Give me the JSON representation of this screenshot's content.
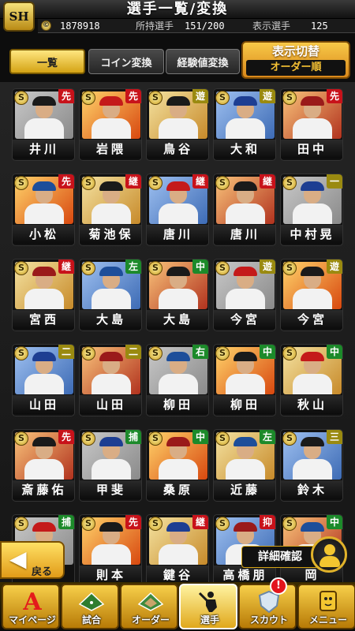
{
  "header": {
    "logo_text": "SH",
    "title": "選手一覧/変換",
    "coins": "1878918",
    "owned_label": "所持選手",
    "owned_value": "151/200",
    "display_label": "表示選手",
    "display_value": "125"
  },
  "tabs": [
    {
      "label": "一覧",
      "active": true
    },
    {
      "label": "コイン変換",
      "active": false
    },
    {
      "label": "経験値変換",
      "active": false
    }
  ],
  "display_toggle": {
    "title": "表示切替",
    "value": "オーダー順"
  },
  "players": [
    {
      "name": "井川",
      "position": "先",
      "badge": "S"
    },
    {
      "name": "岩隈",
      "position": "先",
      "badge": "S"
    },
    {
      "name": "鳥谷",
      "position": "遊",
      "badge": "S"
    },
    {
      "name": "大和",
      "position": "遊",
      "badge": "S"
    },
    {
      "name": "田中",
      "position": "先",
      "badge": "S"
    },
    {
      "name": "小松",
      "position": "先",
      "badge": "S"
    },
    {
      "name": "菊池保",
      "position": "継",
      "badge": "S"
    },
    {
      "name": "唐川",
      "position": "継",
      "badge": "S"
    },
    {
      "name": "唐川",
      "position": "継",
      "badge": "S"
    },
    {
      "name": "中村晃",
      "position": "一",
      "badge": "S"
    },
    {
      "name": "宮西",
      "position": "継",
      "badge": "S"
    },
    {
      "name": "大島",
      "position": "左",
      "badge": "S"
    },
    {
      "name": "大島",
      "position": "中",
      "badge": "S"
    },
    {
      "name": "今宮",
      "position": "遊",
      "badge": "S"
    },
    {
      "name": "今宮",
      "position": "遊",
      "badge": "S"
    },
    {
      "name": "山田",
      "position": "二",
      "badge": "S"
    },
    {
      "name": "山田",
      "position": "二",
      "badge": "S"
    },
    {
      "name": "柳田",
      "position": "右",
      "badge": "S"
    },
    {
      "name": "柳田",
      "position": "中",
      "badge": "S"
    },
    {
      "name": "秋山",
      "position": "中",
      "badge": "S"
    },
    {
      "name": "斎藤佑",
      "position": "先",
      "badge": "S"
    },
    {
      "name": "甲斐",
      "position": "捕",
      "badge": "S"
    },
    {
      "name": "桑原",
      "position": "中",
      "badge": "S"
    },
    {
      "name": "近藤",
      "position": "左",
      "badge": "S"
    },
    {
      "name": "鈴木",
      "position": "三",
      "badge": "S"
    },
    {
      "name": "",
      "position": "捕",
      "badge": "S"
    },
    {
      "name": "則本",
      "position": "先",
      "badge": "S"
    },
    {
      "name": "鍵谷",
      "position": "継",
      "badge": "S"
    },
    {
      "name": "高橋朋",
      "position": "抑",
      "badge": "S"
    },
    {
      "name": "岡",
      "position": "中",
      "badge": "S"
    }
  ],
  "back_button": {
    "label": "戻る"
  },
  "detail_button": {
    "label": "詳細確認"
  },
  "nav": [
    {
      "label": "マイページ",
      "icon": "A"
    },
    {
      "label": "試合",
      "icon": "field-icon"
    },
    {
      "label": "オーダー",
      "icon": "field-icon"
    },
    {
      "label": "選手",
      "icon": "batter-icon"
    },
    {
      "label": "スカウト",
      "icon": "shield-icon"
    },
    {
      "label": "メニュー",
      "icon": "menu-face-icon"
    }
  ],
  "notification": "!",
  "colors": {
    "gold": "#f3c630",
    "red_badge": "#c8121a",
    "green_badge": "#1c8a2a",
    "yellow_badge": "#9a8a10"
  }
}
